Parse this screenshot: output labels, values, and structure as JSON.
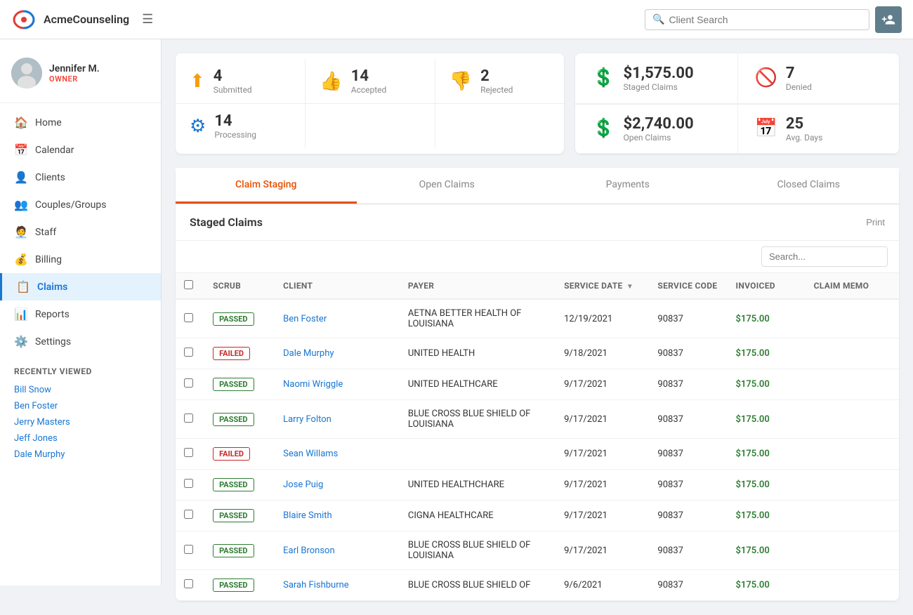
{
  "app": {
    "name": "AcmeCounseling",
    "hamburger": "☰"
  },
  "topnav": {
    "search_placeholder": "Client Search",
    "add_client_icon": "+"
  },
  "user": {
    "name": "Jennifer M.",
    "role": "OWNER"
  },
  "nav": {
    "items": [
      {
        "id": "home",
        "label": "Home",
        "icon": "🏠"
      },
      {
        "id": "calendar",
        "label": "Calendar",
        "icon": "📅"
      },
      {
        "id": "clients",
        "label": "Clients",
        "icon": "👤"
      },
      {
        "id": "couples-groups",
        "label": "Couples/Groups",
        "icon": "👥"
      },
      {
        "id": "staff",
        "label": "Staff",
        "icon": "🧑‍💼"
      },
      {
        "id": "billing",
        "label": "Billing",
        "icon": "💰"
      },
      {
        "id": "claims",
        "label": "Claims",
        "icon": "📋"
      },
      {
        "id": "reports",
        "label": "Reports",
        "icon": "📊"
      },
      {
        "id": "settings",
        "label": "Settings",
        "icon": "⚙️"
      }
    ]
  },
  "recently_viewed": {
    "title": "Recently Viewed",
    "items": [
      {
        "label": "Bill Snow"
      },
      {
        "label": "Ben Foster"
      },
      {
        "label": "Jerry Masters"
      },
      {
        "label": "Jeff Jones"
      },
      {
        "label": "Dale Murphy"
      }
    ]
  },
  "stats_left": {
    "cells": [
      {
        "icon_color": "#f59e0b",
        "icon": "✈",
        "num": "4",
        "label": "Submitted"
      },
      {
        "icon_color": "#2e7d32",
        "icon": "👍",
        "num": "14",
        "label": "Accepted"
      },
      {
        "icon_color": "#1976d2",
        "icon": "⚙",
        "num": "14",
        "label": "Processing"
      },
      {
        "icon_color": "#c62828",
        "icon": "👎",
        "num": "2",
        "label": "Rejected"
      }
    ]
  },
  "stats_right": {
    "cells": [
      {
        "icon_color": "#2e7d32",
        "icon": "$",
        "value": "$1,575.00",
        "label": "Staged Claims"
      },
      {
        "icon_color": "#c62828",
        "icon": "🚫",
        "value": "7",
        "label": "Denied"
      },
      {
        "icon_color": "#2e7d32",
        "icon": "$",
        "value": "$2,740.00",
        "label": "Open Claims"
      },
      {
        "icon_color": "#1976d2",
        "icon": "📅",
        "value": "25",
        "label": "Avg. Days"
      }
    ]
  },
  "tabs": [
    {
      "id": "claim-staging",
      "label": "Claim Staging",
      "active": true
    },
    {
      "id": "open-claims",
      "label": "Open Claims",
      "active": false
    },
    {
      "id": "payments",
      "label": "Payments",
      "active": false
    },
    {
      "id": "closed-claims",
      "label": "Closed Claims",
      "active": false
    }
  ],
  "claims": {
    "title": "Staged Claims",
    "print_label": "Print",
    "columns": [
      "SCRUB",
      "CLIENT",
      "PAYER",
      "SERVICE DATE",
      "SERVICE CODE",
      "INVOICED",
      "CLAIM MEMO"
    ],
    "rows": [
      {
        "scrub": "PASSED",
        "client": "Ben Foster",
        "payer": "AETNA BETTER HEALTH OF LOUISIANA",
        "date": "12/19/2021",
        "code": "90837",
        "invoiced": "$175.00",
        "memo": ""
      },
      {
        "scrub": "FAILED",
        "client": "Dale Murphy",
        "payer": "UNITED HEALTH",
        "date": "9/18/2021",
        "code": "90837",
        "invoiced": "$175.00",
        "memo": ""
      },
      {
        "scrub": "PASSED",
        "client": "Naomi Wriggle",
        "payer": "UNITED HEALTHCARE",
        "date": "9/17/2021",
        "code": "90837",
        "invoiced": "$175.00",
        "memo": ""
      },
      {
        "scrub": "PASSED",
        "client": "Larry Folton",
        "payer": "BLUE CROSS BLUE SHIELD OF LOUISIANA",
        "date": "9/17/2021",
        "code": "90837",
        "invoiced": "$175.00",
        "memo": ""
      },
      {
        "scrub": "FAILED",
        "client": "Sean Willams",
        "payer": "",
        "date": "9/17/2021",
        "code": "90837",
        "invoiced": "$175.00",
        "memo": ""
      },
      {
        "scrub": "PASSED",
        "client": "Jose Puig",
        "payer": "UNITED HEALTHCHARE",
        "date": "9/17/2021",
        "code": "90837",
        "invoiced": "$175.00",
        "memo": ""
      },
      {
        "scrub": "PASSED",
        "client": "Blaire Smith",
        "payer": "CIGNA HEALTHCARE",
        "date": "9/17/2021",
        "code": "90837",
        "invoiced": "$175.00",
        "memo": ""
      },
      {
        "scrub": "PASSED",
        "client": "Earl Bronson",
        "payer": "BLUE CROSS BLUE SHIELD OF LOUISIANA",
        "date": "9/17/2021",
        "code": "90837",
        "invoiced": "$175.00",
        "memo": ""
      },
      {
        "scrub": "PASSED",
        "client": "Sarah Fishburne",
        "payer": "BLUE CROSS BLUE SHIELD OF",
        "date": "9/6/2021",
        "code": "90837",
        "invoiced": "$175.00",
        "memo": ""
      }
    ]
  }
}
